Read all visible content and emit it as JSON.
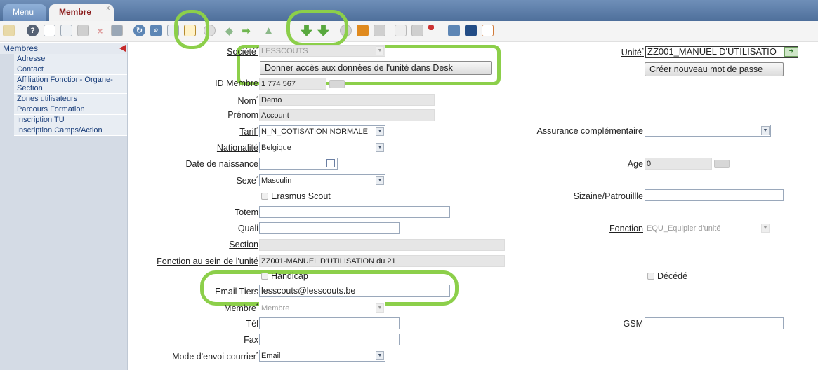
{
  "tabs": {
    "menu": "Menu",
    "membre": "Membre",
    "close": "x"
  },
  "sidebar": {
    "title": "Membres",
    "items": [
      "Adresse",
      "Contact",
      "Affiliation Fonction- Organe-Section",
      "Zones utilisateurs",
      "Parcours Formation",
      "Inscription TU",
      "Inscription Camps/Action"
    ]
  },
  "form": {
    "societe": {
      "label": "Société",
      "value": "LESSCOUTS"
    },
    "donner_acces_button": "Donner accès aux données de l'unité dans Desk",
    "unite": {
      "label": "Unité",
      "value": "ZZ001_MANUEL D'UTILISATIO"
    },
    "creer_mdp_button": "Créer nouveau mot de passe",
    "id_membre": {
      "label": "ID Membre",
      "value": "1 774 567"
    },
    "nom": {
      "label": "Nom",
      "value": "Demo"
    },
    "prenom": {
      "label": "Prénom",
      "value": "Account"
    },
    "tarif": {
      "label": "Tarif",
      "value": "N_N_COTISATION NORMALE"
    },
    "assurance": {
      "label": "Assurance complémentaire",
      "value": ""
    },
    "nationalite": {
      "label": "Nationalité",
      "value": "Belgique"
    },
    "date_naissance": {
      "label": "Date de naissance",
      "value": ""
    },
    "age": {
      "label": "Age",
      "value": "0"
    },
    "sexe": {
      "label": "Sexe",
      "value": "Masculin"
    },
    "erasmus": {
      "label": "Erasmus Scout"
    },
    "sizaine": {
      "label": "Sizaine/Patrouillle",
      "value": ""
    },
    "totem": {
      "label": "Totem",
      "value": ""
    },
    "quali": {
      "label": "Quali",
      "value": ""
    },
    "fonction": {
      "label": "Fonction",
      "value": "EQU_Equipier d'unité"
    },
    "section": {
      "label": "Section",
      "value": ""
    },
    "fonction_unite": {
      "label": "Fonction au sein de l'unité",
      "value": "ZZ001-MANUEL D'UTILISATION du 21"
    },
    "handicap": {
      "label": "Handicap"
    },
    "decede": {
      "label": "Décédé"
    },
    "email_tiers": {
      "label": "Email Tiers",
      "value": "lesscouts@lesscouts.be"
    },
    "membre": {
      "label": "Membre",
      "value": "Membre"
    },
    "tel": {
      "label": "Tél",
      "value": ""
    },
    "gsm": {
      "label": "GSM",
      "value": ""
    },
    "fax": {
      "label": "Fax",
      "value": ""
    },
    "mode_envoi": {
      "label": "Mode d'envoi courrier",
      "value": "Email"
    }
  },
  "colors": {
    "highlight_ring": "#8ccf4a",
    "tab_active_text": "#8a1a1a",
    "sidebar_bg": "#d4dbe5"
  }
}
